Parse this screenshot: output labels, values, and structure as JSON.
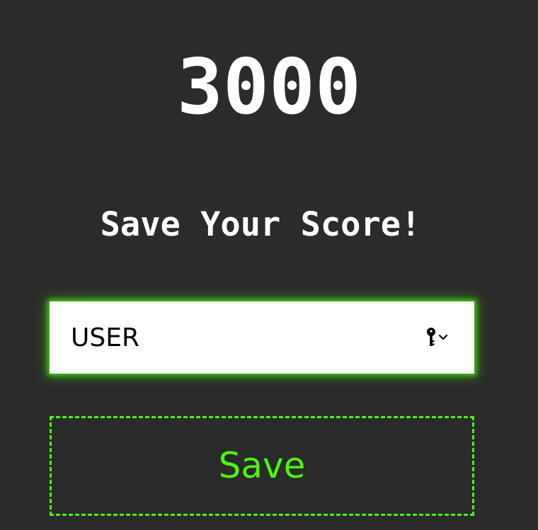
{
  "score": {
    "value": "3000"
  },
  "heading": {
    "text": "Save Your Score!"
  },
  "name_field": {
    "value": "USER",
    "placeholder": "USER",
    "autofill_icon": "key-icon",
    "dropdown_icon": "chevron-down-icon"
  },
  "save_button": {
    "label": "Save"
  },
  "colors": {
    "background": "#2b2b2b",
    "accent": "#4cf514",
    "text": "#ffffff"
  }
}
